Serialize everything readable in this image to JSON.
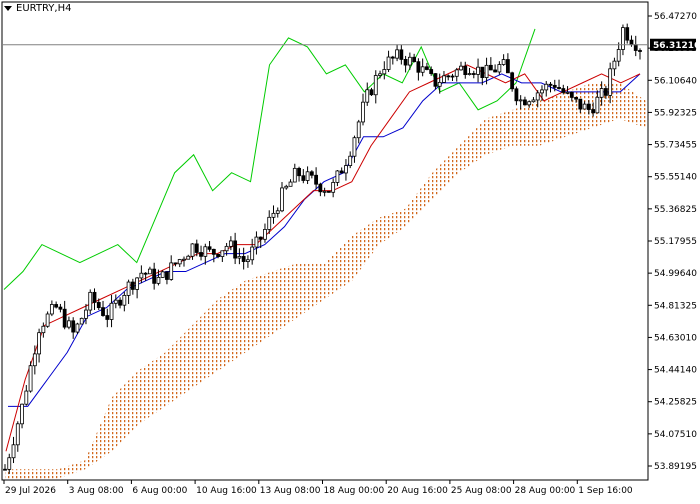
{
  "header": {
    "symbol_label": "EURTRY,H4"
  },
  "colors": {
    "background": "#ffffff",
    "candle_bull": "#ffffff",
    "candle_bear": "#000000",
    "tenkan": "#cc0000",
    "kijun": "#0000cc",
    "chikou": "#00cc00",
    "kumo": "#d2691e",
    "price_line": "#808080",
    "price_label_bg": "#000000",
    "price_label_text": "#ffffff"
  },
  "chart_data": {
    "type": "candlestick",
    "title": "EURTRY,H4",
    "indicator": "Ichimoku Kinko Hyo",
    "current_price": 56.31216,
    "current_price_label": "56.31216",
    "ylim": [
      53.89,
      56.55
    ],
    "y_ticks": [
      "56.47270",
      "56.28995",
      "56.10640",
      "55.92325",
      "55.73455",
      "55.55140",
      "55.36825",
      "55.17955",
      "54.99640",
      "54.81325",
      "54.63010",
      "54.44140",
      "54.25825",
      "54.07510",
      "53.89195"
    ],
    "x_ticks": [
      "29 Jul 2026",
      "3 Aug 08:00",
      "6 Aug 00:00",
      "10 Aug 16:00",
      "13 Aug 08:00",
      "18 Aug 00:00",
      "20 Aug 16:00",
      "25 Aug 08:00",
      "28 Aug 00:00",
      "1 Sep 16:00"
    ],
    "price_path": [
      53.95,
      54.3,
      54.75,
      54.85,
      54.7,
      54.9,
      54.8,
      54.95,
      55.05,
      55.0,
      55.1,
      55.2,
      55.15,
      55.2,
      55.1,
      55.25,
      55.45,
      55.6,
      55.55,
      55.5,
      55.7,
      56.0,
      56.2,
      56.25,
      56.2,
      56.1,
      56.15,
      56.2,
      56.15,
      56.2,
      56.0,
      56.05,
      56.1,
      56.0,
      55.95,
      56.05,
      56.4,
      56.3
    ],
    "tenkan_path": [
      54.05,
      54.45,
      54.75,
      54.8,
      54.85,
      54.9,
      54.95,
      55.0,
      55.05,
      55.1,
      55.15,
      55.15,
      55.2,
      55.2,
      55.3,
      55.4,
      55.5,
      55.5,
      55.55,
      55.75,
      55.9,
      56.05,
      56.1,
      56.15,
      56.2,
      56.15,
      56.1,
      56.15,
      56.0,
      56.05,
      56.1,
      56.15,
      56.1,
      56.15
    ],
    "kijun_path": [
      54.3,
      54.3,
      54.45,
      54.6,
      54.8,
      54.85,
      54.95,
      55.0,
      55.05,
      55.05,
      55.1,
      55.15,
      55.15,
      55.2,
      55.3,
      55.45,
      55.55,
      55.6,
      55.8,
      55.8,
      55.85,
      56.0,
      56.1,
      56.1,
      56.1,
      56.15,
      56.1,
      56.1,
      56.05,
      56.05,
      56.05,
      56.05,
      56.15
    ],
    "chikou_path": [
      54.95,
      55.05,
      55.2,
      55.15,
      55.1,
      55.15,
      55.2,
      55.1,
      55.35,
      55.6,
      55.7,
      55.5,
      55.6,
      55.55,
      56.2,
      56.35,
      56.3,
      56.15,
      56.2,
      56.05,
      56.15,
      56.1,
      56.3,
      56.05,
      56.1,
      55.95,
      56.0,
      56.1,
      56.4
    ],
    "kumo_upper_path": [
      53.95,
      53.95,
      53.95,
      54.0,
      54.35,
      54.5,
      54.6,
      54.75,
      54.9,
      55.0,
      55.05,
      55.1,
      55.1,
      55.25,
      55.35,
      55.4,
      55.6,
      55.75,
      55.9,
      55.95,
      56.0,
      56.05,
      56.1,
      56.1,
      56.0
    ],
    "kumo_lower_path": [
      53.89,
      53.89,
      53.9,
      53.95,
      54.05,
      54.2,
      54.3,
      54.4,
      54.5,
      54.6,
      54.7,
      54.8,
      54.9,
      55.0,
      55.2,
      55.3,
      55.45,
      55.6,
      55.7,
      55.75,
      55.75,
      55.8,
      55.85,
      55.9,
      55.85
    ]
  }
}
